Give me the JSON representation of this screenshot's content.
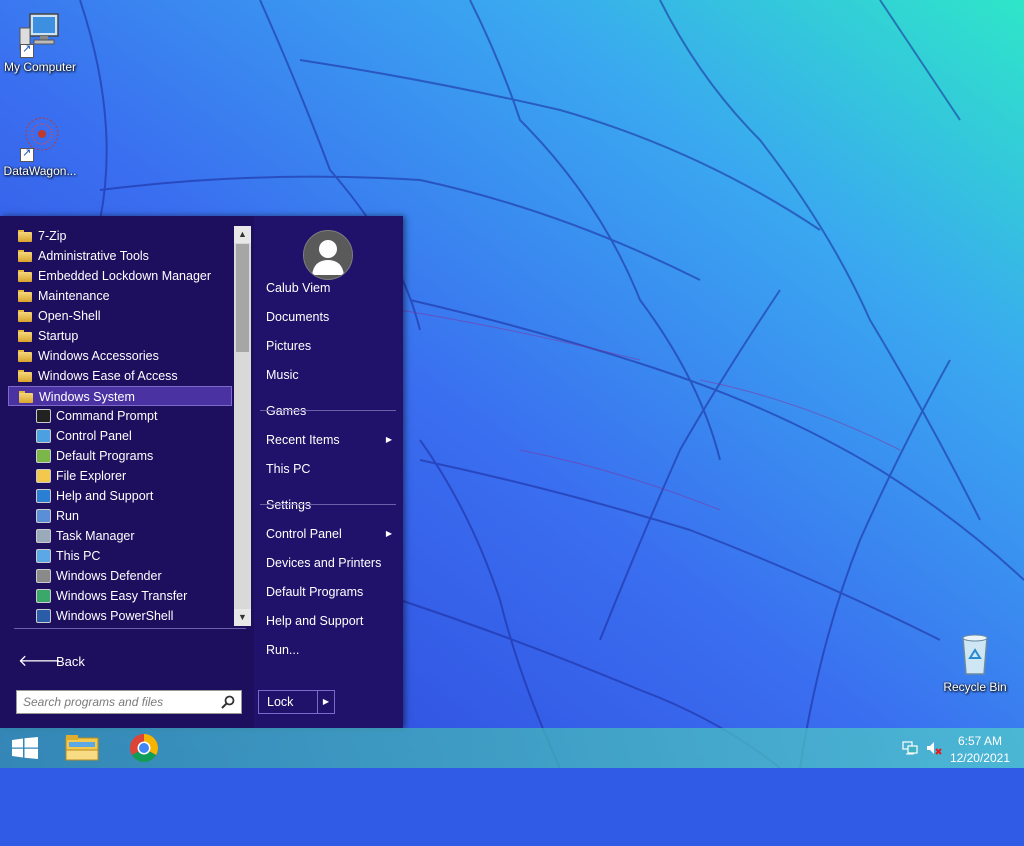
{
  "desktop": {
    "icons": [
      {
        "label": "My Computer",
        "icon": "computer-icon"
      },
      {
        "label": "DataWagon...",
        "icon": "datawagon-icon"
      },
      {
        "label": "Recycle Bin",
        "icon": "recycle-bin-icon"
      }
    ]
  },
  "start_menu": {
    "programs": [
      {
        "label": "7-Zip",
        "type": "folder"
      },
      {
        "label": "Administrative Tools",
        "type": "folder"
      },
      {
        "label": "Embedded Lockdown Manager",
        "type": "folder"
      },
      {
        "label": "Maintenance",
        "type": "folder"
      },
      {
        "label": "Open-Shell",
        "type": "folder"
      },
      {
        "label": "Startup",
        "type": "folder"
      },
      {
        "label": "Windows Accessories",
        "type": "folder"
      },
      {
        "label": "Windows Ease of Access",
        "type": "folder"
      },
      {
        "label": "Windows System",
        "type": "folder",
        "selected": true
      },
      {
        "label": "Command Prompt",
        "type": "app",
        "icon": "command-prompt-icon"
      },
      {
        "label": "Control Panel",
        "type": "app",
        "icon": "control-panel-icon"
      },
      {
        "label": "Default Programs",
        "type": "app",
        "icon": "default-programs-icon"
      },
      {
        "label": "File Explorer",
        "type": "app",
        "icon": "file-explorer-icon"
      },
      {
        "label": "Help and Support",
        "type": "app",
        "icon": "help-icon"
      },
      {
        "label": "Run",
        "type": "app",
        "icon": "run-icon"
      },
      {
        "label": "Task Manager",
        "type": "app",
        "icon": "task-manager-icon"
      },
      {
        "label": "This PC",
        "type": "app",
        "icon": "this-pc-icon"
      },
      {
        "label": "Windows Defender",
        "type": "app",
        "icon": "windows-defender-icon"
      },
      {
        "label": "Windows Easy Transfer",
        "type": "app",
        "icon": "easy-transfer-icon"
      },
      {
        "label": "Windows PowerShell",
        "type": "app",
        "icon": "powershell-icon"
      }
    ],
    "back_label": "Back",
    "search_placeholder": "Search programs and files",
    "right_items": [
      {
        "label": "Calub Viem"
      },
      {
        "label": "Documents"
      },
      {
        "label": "Pictures"
      },
      {
        "label": "Music"
      },
      {
        "label": "Games"
      },
      {
        "label": "Recent Items",
        "submenu": true
      },
      {
        "label": "This PC"
      },
      {
        "label": "Settings"
      },
      {
        "label": "Control Panel",
        "submenu": true
      },
      {
        "label": "Devices and Printers"
      },
      {
        "label": "Default Programs"
      },
      {
        "label": "Help and Support"
      },
      {
        "label": "Run..."
      }
    ],
    "lock_label": "Lock"
  },
  "taskbar": {
    "apps": [
      {
        "icon": "file-explorer-icon"
      },
      {
        "icon": "chrome-icon"
      }
    ],
    "clock": {
      "time": "6:57 AM",
      "date": "12/20/2021"
    }
  },
  "colors": {
    "menu_bg": "#1d0f5e",
    "selection": "#4a32a3",
    "taskbar": "#3fb2bd"
  }
}
